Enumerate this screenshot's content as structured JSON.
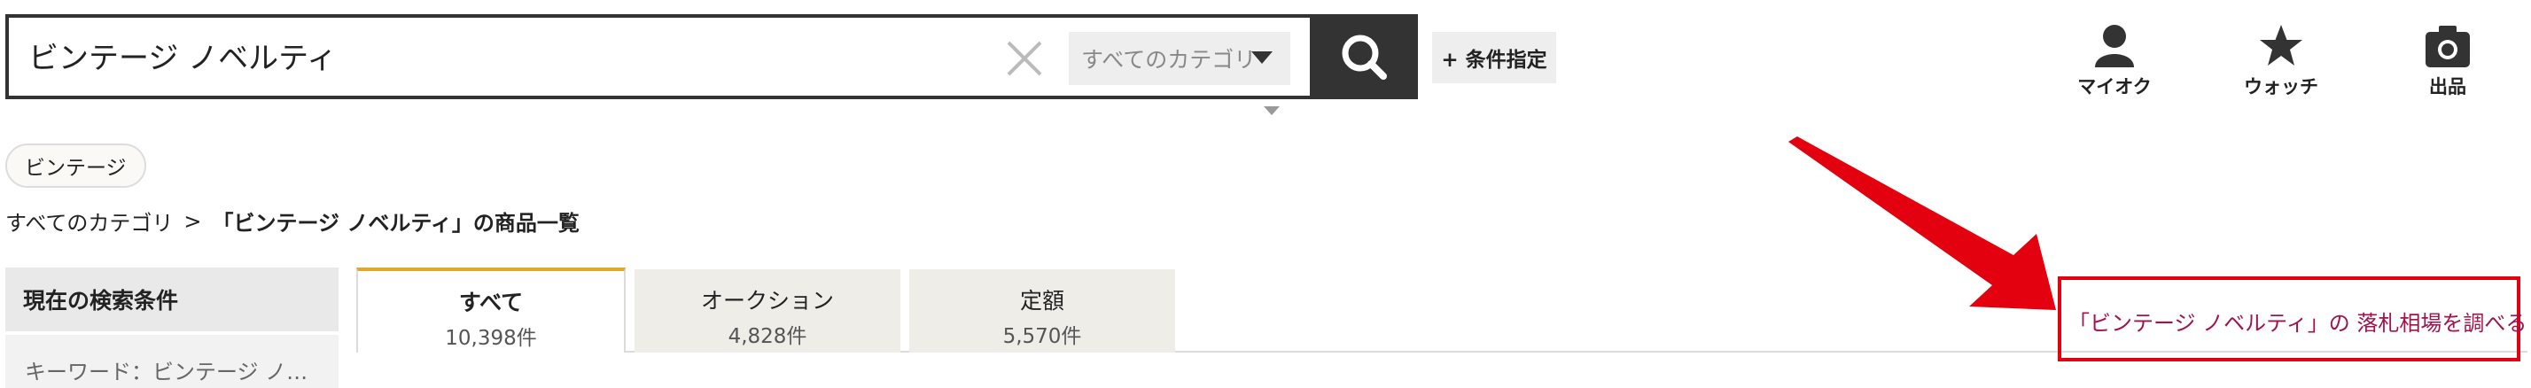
{
  "search": {
    "query": "ビンテージ ノベルティ",
    "category_value": "すべてのカテゴリ",
    "condition_label": "+ 条件指定"
  },
  "header_icons": [
    {
      "label": "マイオク",
      "icon": "person-icon"
    },
    {
      "label": "ウォッチ",
      "icon": "star-icon"
    },
    {
      "label": "出品",
      "icon": "camera-icon"
    }
  ],
  "tag": "ビンテージ",
  "breadcrumb": {
    "root": "すべてのカテゴリ",
    "separator": ">",
    "current": "「ビンテージ ノベルティ」の商品一覧"
  },
  "sidebar": {
    "heading": "現在の検索条件",
    "keyword": "キーワード：ビンテージ ノ…"
  },
  "tabs": [
    {
      "label": "すべて",
      "count": "10,398件",
      "active": true
    },
    {
      "label": "オークション",
      "count": "4,828件",
      "active": false
    },
    {
      "label": "定額",
      "count": "5,570件",
      "active": false
    }
  ],
  "market_link": "「ビンテージ ノベルティ」の 落札相場を調べる",
  "colors": {
    "search_button": "#333333",
    "tab_accent": "#e0a92b",
    "annotation_red": "#e3000f",
    "link": "#a1124e"
  }
}
